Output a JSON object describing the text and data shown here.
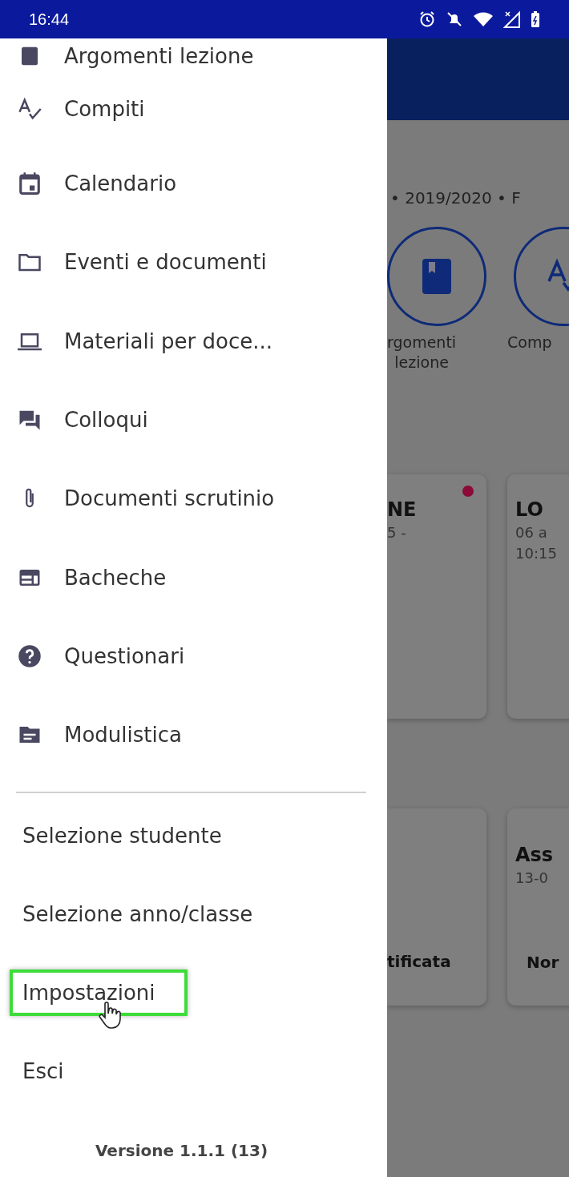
{
  "status_bar": {
    "time": "16:44"
  },
  "drawer": {
    "items": [
      {
        "label": "Argomenti lezione"
      },
      {
        "label": "Compiti"
      },
      {
        "label": "Calendario"
      },
      {
        "label": "Eventi e documenti"
      },
      {
        "label": "Materiali per doce..."
      },
      {
        "label": "Colloqui"
      },
      {
        "label": "Documenti scrutinio"
      },
      {
        "label": "Bacheche"
      },
      {
        "label": "Questionari"
      },
      {
        "label": "Modulistica"
      }
    ],
    "links": [
      {
        "label": "Selezione studente",
        "highlighted": false
      },
      {
        "label": "Selezione anno/classe",
        "highlighted": false
      },
      {
        "label": "Impostazioni",
        "highlighted": true
      },
      {
        "label": "Esci",
        "highlighted": false
      }
    ],
    "version": "Versione 1.1.1 (13)"
  },
  "background": {
    "subtitle": "• 2019/2020 • F",
    "shortcuts": [
      {
        "label": "rgomenti\nlezione"
      },
      {
        "label": "Comp"
      }
    ],
    "cards_top": [
      {
        "title": "NE",
        "lines": [
          "5 -"
        ],
        "unread": true
      },
      {
        "title": "LO",
        "lines": [
          "06 a",
          "10:15"
        ],
        "unread": false
      }
    ],
    "cards_bottom": [
      {
        "status": "tificata"
      },
      {
        "title": "Ass",
        "date": "13-0",
        "status": "Nor"
      }
    ]
  }
}
